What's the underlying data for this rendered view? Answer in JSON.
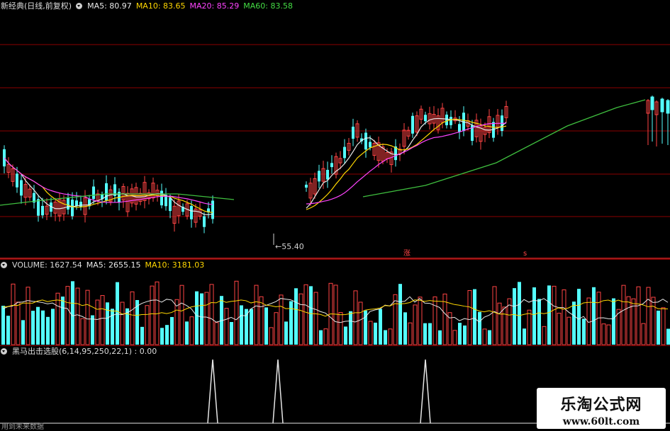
{
  "price_header": {
    "title": "新经典(日线,前复权)",
    "ma5": "MA5: 80.97",
    "ma10": "MA10: 83.65",
    "ma20": "MA20: 85.29",
    "ma60": "MA60: 83.58",
    "colors": {
      "ma5": "#e8e8e8",
      "ma10": "#ffd700",
      "ma20": "#ff44ff",
      "ma60": "#44dd44"
    }
  },
  "price_annotations": {
    "low_label": "←55.40",
    "marker_zhang": "涨",
    "marker_s": "s"
  },
  "volume_header": {
    "title": "VOLUME: 1627.54",
    "ma5": "MA5: 2655.15",
    "ma10": "MA10: 3181.03"
  },
  "indicator_header": {
    "title": "黑马出击选股(6,14,95,250,22,1) : 0.00"
  },
  "footer_note": "用到未来数据",
  "watermark": {
    "title": "乐淘公式网",
    "url": "www.60lt.com"
  },
  "colors": {
    "up": "#ff4444",
    "down": "#54ffff",
    "grid": "#8b0000",
    "ma60": "#3fbf3f"
  }
}
